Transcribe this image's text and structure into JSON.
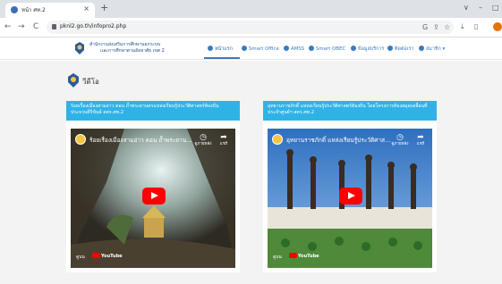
{
  "browser": {
    "tab_title": "หน้า ศท.2",
    "tab_close": "×",
    "new_tab": "+",
    "url": "pknl2.go.th/infopro2.php",
    "nav": {
      "back": "←",
      "forward": "→",
      "reload": "C"
    },
    "window": {
      "minimize": "–",
      "maximize": "□",
      "chevron": "∨"
    },
    "toolbar_icons": {
      "translate": "G",
      "share": "⇪",
      "star": "☆",
      "download": "⤓",
      "sidebar": "▯"
    }
  },
  "site": {
    "org_name_line1": "สำนักงานส่งเสริมการศึกษานอกระบบ",
    "org_name_line2": "และการศึกษาตามอัธยาศัย เขต 2",
    "menu": [
      {
        "label": "หน้าแรก",
        "active": true
      },
      {
        "label": "Smart Office",
        "active": false
      },
      {
        "label": "AMSS",
        "active": false
      },
      {
        "label": "Smart OBEC",
        "active": false
      },
      {
        "label": "ข้อมูลบริการ",
        "active": false
      },
      {
        "label": "ติดต่อเรา",
        "active": false
      },
      {
        "label": "สมาชิก ▾",
        "active": false
      }
    ]
  },
  "section": {
    "title": "วีดีโอ"
  },
  "videos": [
    {
      "caption": "ร้อยเรื่องเมืองสามอ่าว ตอน ถ้ำพระยานครแหล่งเรียนรู้ประวัติศาสตร์ท้องถิ่น ประจวบคีรีขันธ์ สคร.ศท.2",
      "title": "ร้อยเรื่องเมืองสามอ่าว ตอน ถ้ำพระยาน...",
      "watch_later": "ดูภายหลัง",
      "share": "แชร์",
      "watch_on": "ดูบน",
      "youtube": "YouTube"
    },
    {
      "caption": "อุทยานราชภักดิ์ แหล่งเรียนรู้ประวัติศาสตร์ท้องถิ่น โดยโครงการห้องสมุดเคลื่อนที่ประจำศูนย์ฯ สคร.ศท.2",
      "title": "อุทยานราชภักดิ์ แหล่งเรียนรู้ประวัติศาสตร์...",
      "watch_later": "ดูภายหลัง",
      "share": "แชร์",
      "watch_on": "ดูบน",
      "youtube": "YouTube"
    }
  ]
}
